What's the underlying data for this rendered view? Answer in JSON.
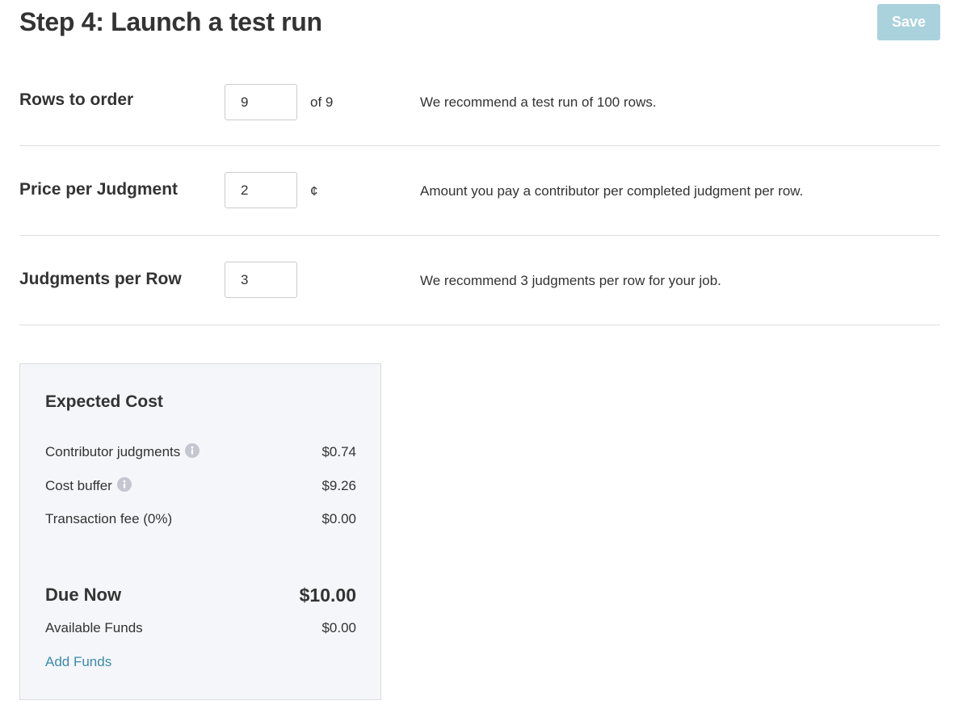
{
  "header": {
    "title": "Step 4: Launch a test run",
    "save_label": "Save"
  },
  "form": {
    "rows": [
      {
        "label": "Rows to order",
        "value": "9",
        "suffix": "of 9",
        "hint": "We recommend a test run of 100 rows."
      },
      {
        "label": "Price per Judgment",
        "value": "2",
        "suffix": "¢",
        "hint": "Amount you pay a contributor per completed judgment per row."
      },
      {
        "label": "Judgments per Row",
        "value": "3",
        "suffix": "",
        "hint": "We recommend 3 judgments per row for your job."
      }
    ]
  },
  "cost": {
    "title": "Expected Cost",
    "lines": [
      {
        "label": "Contributor judgments",
        "value": "$0.74",
        "info_icon": "info-icon"
      },
      {
        "label": "Cost buffer",
        "value": "$9.26",
        "info_icon": "info-icon"
      },
      {
        "label": "Transaction fee (0%)",
        "value": "$0.00"
      }
    ],
    "due_label": "Due Now",
    "due_value": "$10.00",
    "funds_label": "Available Funds",
    "funds_value": "$0.00",
    "add_funds_label": "Add Funds"
  },
  "colors": {
    "save_button_bg": "#a9d2dc",
    "link": "#3c8ba8",
    "card_bg": "#f5f6fa",
    "divider": "#dddddd",
    "text": "#333333"
  }
}
